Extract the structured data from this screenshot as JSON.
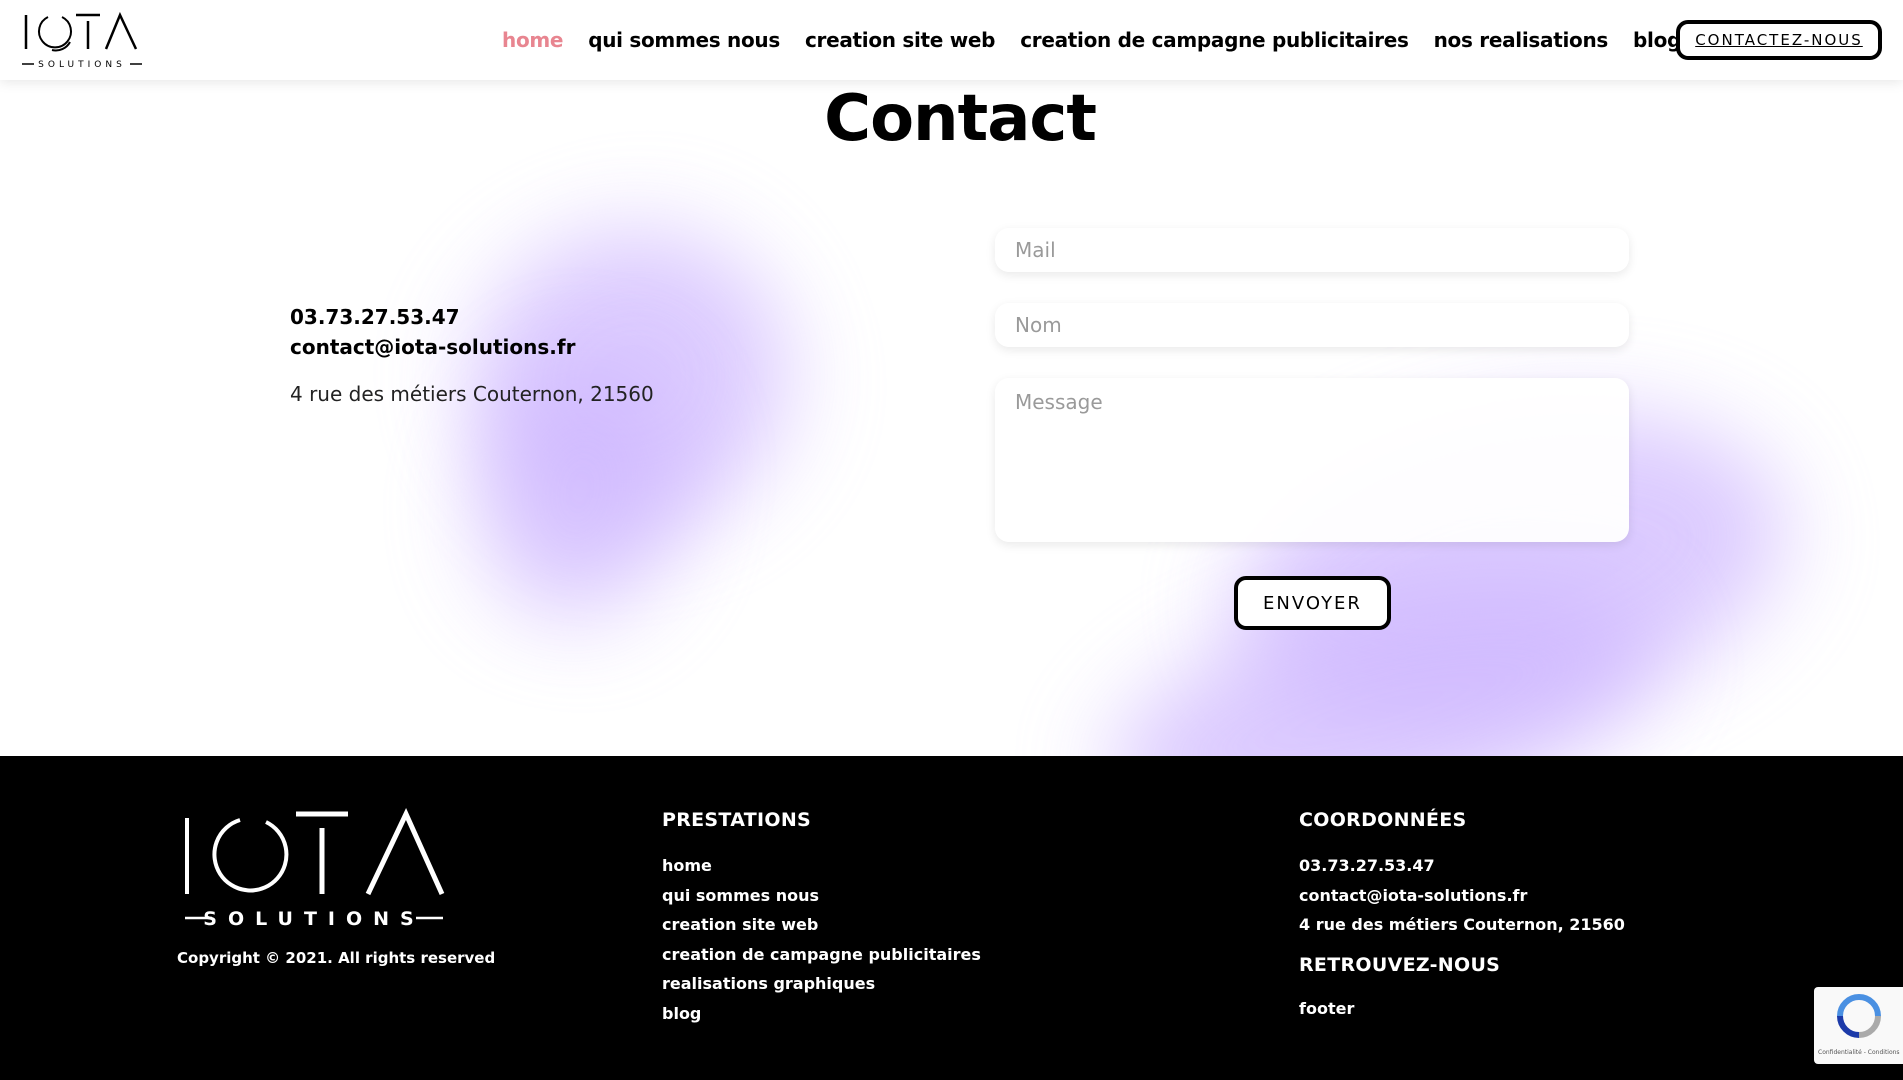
{
  "header": {
    "logo_text": "IOTA SOLUTIONS",
    "nav": [
      {
        "label": "home",
        "active": true
      },
      {
        "label": "qui sommes nous",
        "active": false
      },
      {
        "label": "creation site web",
        "active": false
      },
      {
        "label": "creation de campagne publicitaires",
        "active": false
      },
      {
        "label": "nos realisations",
        "active": false
      },
      {
        "label": "blog",
        "active": false
      }
    ],
    "cta_label": "CONTACTEZ-NOUS"
  },
  "contact": {
    "title": "Contact",
    "phone": "03.73.27.53.47",
    "email": "contact@iota-solutions.fr",
    "address": "4 rue des métiers Couternon, 21560",
    "form": {
      "mail_placeholder": "Mail",
      "nom_placeholder": "Nom",
      "message_placeholder": "Message",
      "submit_label": "ENVOYER"
    }
  },
  "footer": {
    "logo_text": "IOTA SOLUTIONS",
    "copyright": "Copyright © 2021. All rights reserved",
    "prestations": {
      "heading": "PRESTATIONS",
      "links": [
        "home",
        "qui sommes nous",
        "creation site web",
        "creation de campagne publicitaires",
        "realisations graphiques",
        "blog"
      ]
    },
    "coordonnees": {
      "heading": "COORDONNÉES",
      "phone": "03.73.27.53.47",
      "email": "contact@iota-solutions.fr",
      "address": "4 rue des métiers Couternon, 21560"
    },
    "retrouvez": {
      "heading": "RETROUVEZ-NOUS",
      "link": "footer"
    }
  },
  "recaptcha": {
    "text": "Confidentialité - Conditions"
  },
  "colors": {
    "accent_active": "#e88590",
    "blob": "#cdb5ff",
    "footer_bg": "#000000"
  }
}
